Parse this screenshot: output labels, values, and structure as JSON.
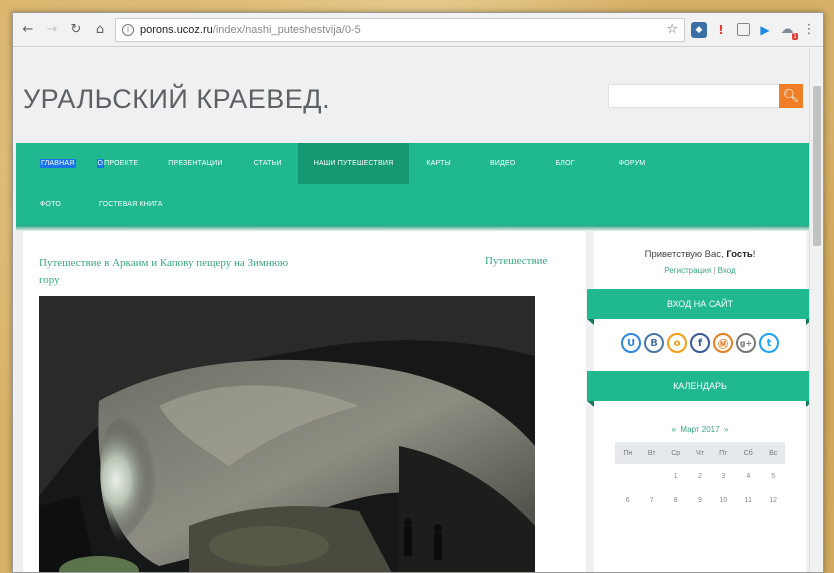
{
  "browser": {
    "url_host": "porons.ucoz.ru",
    "url_path": "/index/nashi_puteshestvija/0-5",
    "icons": [
      "back-arrow-icon",
      "forward-arrow-icon",
      "reload-icon",
      "home-icon",
      "info-icon",
      "bookmark-star-icon",
      "menu-dots-icon"
    ]
  },
  "site": {
    "title": "УРАЛЬСКИЙ КРАЕВЕД.",
    "search_placeholder": ""
  },
  "nav": {
    "row1": [
      {
        "label": "ГЛАВНАЯ",
        "highlight": "full"
      },
      {
        "label_hl": "О",
        "label_rest": " ПРОЕКТЕ"
      },
      {
        "label": "ПРЕЗЕНТАЦИИ"
      },
      {
        "label": "СТАТЬИ"
      },
      {
        "label": "НАШИ ПУТЕШЕСТВИЯ",
        "active": true
      },
      {
        "label": "КАРТЫ"
      },
      {
        "label": "ВИДЕО"
      },
      {
        "label": "БЛОГ"
      },
      {
        "label": "ФОРУМ"
      }
    ],
    "row2": [
      {
        "label": "ФОТО"
      },
      {
        "label": "ГОСТЕВАЯ КНИГА"
      }
    ]
  },
  "post": {
    "title": "Путешествие в Аркаим и Капову пещеру на Зимнюю гору",
    "category": "Путешествие"
  },
  "sidebar": {
    "greeting_prefix": "Приветствую Вас, ",
    "greeting_user": "Гость",
    "greeting_suffix": "!",
    "register": "Регистрация",
    "separator": "|",
    "login": "Вход",
    "login_title": "ВХОД НА САЙТ",
    "social": [
      {
        "glyph": "U",
        "color": "#2e86de",
        "name": "ucoz-icon"
      },
      {
        "glyph": "B",
        "color": "#4a76a8",
        "name": "vk-icon"
      },
      {
        "glyph": "o",
        "color": "#f39c12",
        "name": "odnoklassniki-icon"
      },
      {
        "glyph": "f",
        "color": "#3b5998",
        "name": "facebook-icon"
      },
      {
        "glyph": "Ⓜ",
        "color": "#e67e22",
        "name": "mailru-icon"
      },
      {
        "glyph": "g+",
        "color": "#777777",
        "name": "google-plus-icon"
      },
      {
        "glyph": "t",
        "color": "#1da1f2",
        "name": "twitter-icon"
      }
    ],
    "calendar_title": "КАЛЕНДАРЬ",
    "calendar_prev": "«",
    "calendar_month": "Март 2017",
    "calendar_next": "»",
    "weekdays": [
      "Пн",
      "Вт",
      "Ср",
      "Чт",
      "Пт",
      "Сб",
      "Вс"
    ],
    "week1": [
      "",
      "",
      "1",
      "2",
      "3",
      "4",
      "5"
    ],
    "week2": [
      "6",
      "7",
      "8",
      "9",
      "10",
      "11",
      "12"
    ]
  }
}
